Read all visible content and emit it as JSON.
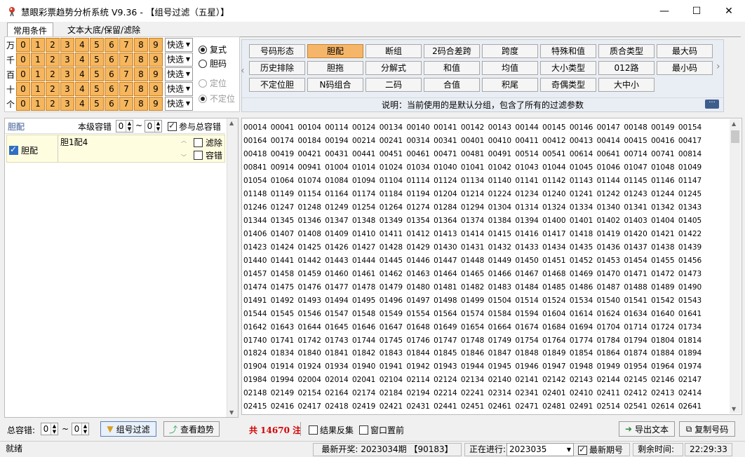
{
  "window": {
    "title": "慧眼彩票趋势分析系统 V9.36 - 【组号过滤（五星）】",
    "min_glyph": "—",
    "max_glyph": "☐",
    "close_glyph": "✕"
  },
  "tabs": [
    "常用条件",
    "文本大底/保留/滤除"
  ],
  "digits": {
    "rows": [
      "万",
      "千",
      "百",
      "十",
      "个"
    ],
    "values": [
      "0",
      "1",
      "2",
      "3",
      "4",
      "5",
      "6",
      "7",
      "8",
      "9"
    ],
    "quick_label": "快选",
    "mode_options": [
      {
        "label": "复式",
        "checked": true,
        "enabled": true
      },
      {
        "label": "胆码",
        "checked": false,
        "enabled": true
      },
      {
        "label": "定位",
        "checked": false,
        "enabled": false
      },
      {
        "label": "不定位",
        "checked": true,
        "enabled": false
      }
    ]
  },
  "filters": {
    "buttons": [
      [
        "号码形态",
        "胆配",
        "断组",
        "2码合差跨",
        "跨度",
        "特殊和值",
        "质合类型",
        "最大码"
      ],
      [
        "历史排除",
        "胆拖",
        "分解式",
        "和值",
        "均值",
        "大小类型",
        "012路",
        "最小码"
      ],
      [
        "不定位胆",
        "N码组合",
        "二码",
        "合值",
        "积尾",
        "奇偶类型",
        "大中小",
        ""
      ]
    ],
    "selected": "胆配",
    "left_arrow": "‹",
    "right_arrow": "›",
    "description": "说明：当前使用的是默认分组，包含了所有的过滤参数",
    "more_label": "···"
  },
  "left_panel": {
    "section_title": "胆配",
    "tolerance_label": "本级容错",
    "tol_min": "0",
    "tol_sep": "~",
    "tol_max": "0",
    "participate_label": "参与总容错",
    "item_name": "胆配",
    "item_value": "胆1配4",
    "filter_label": "滤除",
    "tolerance_check_label": "容错"
  },
  "numbers_text": "00014 00041 00104 00114 00124 00134 00140 00141 00142 00143 00144 00145 00146 00147 00148 00149 00154 00164 00174 00184 00194 00214 00241 00314 00341 00401 00410 00411 00412 00413 00414 00415 00416 00417 00418 00419 00421 00431 00441 00451 00461 00471 00481 00491 00514 00541 00614 00641 00714 00741 00814 00841 00914 00941 01004 01014 01024 01034 01040 01041 01042 01043 01044 01045 01046 01047 01048 01049 01054 01064 01074 01084 01094 01104 01114 01124 01134 01140 01141 01142 01143 01144 01145 01146 01147 01148 01149 01154 01164 01174 01184 01194 01204 01214 01224 01234 01240 01241 01242 01243 01244 01245 01246 01247 01248 01249 01254 01264 01274 01284 01294 01304 01314 01324 01334 01340 01341 01342 01343 01344 01345 01346 01347 01348 01349 01354 01364 01374 01384 01394 01400 01401 01402 01403 01404 01405 01406 01407 01408 01409 01410 01411 01412 01413 01414 01415 01416 01417 01418 01419 01420 01421 01422 01423 01424 01425 01426 01427 01428 01429 01430 01431 01432 01433 01434 01435 01436 01437 01438 01439 01440 01441 01442 01443 01444 01445 01446 01447 01448 01449 01450 01451 01452 01453 01454 01455 01456 01457 01458 01459 01460 01461 01462 01463 01464 01465 01466 01467 01468 01469 01470 01471 01472 01473 01474 01475 01476 01477 01478 01479 01480 01481 01482 01483 01484 01485 01486 01487 01488 01489 01490 01491 01492 01493 01494 01495 01496 01497 01498 01499 01504 01514 01524 01534 01540 01541 01542 01543 01544 01545 01546 01547 01548 01549 01554 01564 01574 01584 01594 01604 01614 01624 01634 01640 01641 01642 01643 01644 01645 01646 01647 01648 01649 01654 01664 01674 01684 01694 01704 01714 01724 01734 01740 01741 01742 01743 01744 01745 01746 01747 01748 01749 01754 01764 01774 01784 01794 01804 01814 01824 01834 01840 01841 01842 01843 01844 01845 01846 01847 01848 01849 01854 01864 01874 01884 01894 01904 01914 01924 01934 01940 01941 01942 01943 01944 01945 01946 01947 01948 01949 01954 01964 01974 01984 01994 02004 02014 02041 02104 02114 02124 02134 02140 02141 02142 02143 02144 02145 02146 02147 02148 02149 02154 02164 02174 02184 02194 02214 02241 02314 02341 02401 02410 02411 02412 02413 02414 02415 02416 02417 02418 02419 02421 02431 02441 02451 02461 02471 02481 02491 02514 02541 02614 02641 02714 02741 02814 02841 02914 02941 03014 03041 03104 03114 03124 03134 03140 03141 03142 03143 03144 03145 03146 03147 03148 03149 03154 03164 03174 03184 03194 03214 03241 03314 03341 03401 03410 03411 03412 03413 03414 03415 03416 03417 03418 03419 03421 03431 03441 03451 03461 03471 03481 03491 03514 03541 03614 03641 03714 03741 03814 03841 03914 03941 04001 04010 04011 04012 04013 04014 04015 04016 04017 04018 04019 04021 04031 04041 04051 04061 04071 04081 04091 04100 04101 04102 04103 04104 04105 04106 04107 04108 04109 04110 04111 04112 04113 04114 04115 04116 04117 04118 04119 04120 04121 04122 04123 04124 04125 04126 04127 04128 04129 04130 04131 04132 04133 04134 04135 04136 04137 04138 04139 04140 04141",
  "bottom": {
    "total_tol_label": "总容错:",
    "tol_min": "0",
    "tol_sep": "~",
    "tol_max": "0",
    "filter_button": "组号过滤",
    "trend_button": "查看趋势",
    "count_text": "共 14670 注",
    "result_reverse": "结果反集",
    "window_top": "窗口置前",
    "export_text": "导出文本",
    "copy_numbers": "复制号码",
    "count_color": "#d10000"
  },
  "status": {
    "ready": "就绪",
    "latest_draw": "最新开奖: 2023034期 【90183】",
    "in_progress_label": "正在进行:",
    "in_progress_value": "2023035",
    "latest_issue_label": "最新期号",
    "remaining_label": "剩余时间:",
    "time": "22:29:33"
  }
}
